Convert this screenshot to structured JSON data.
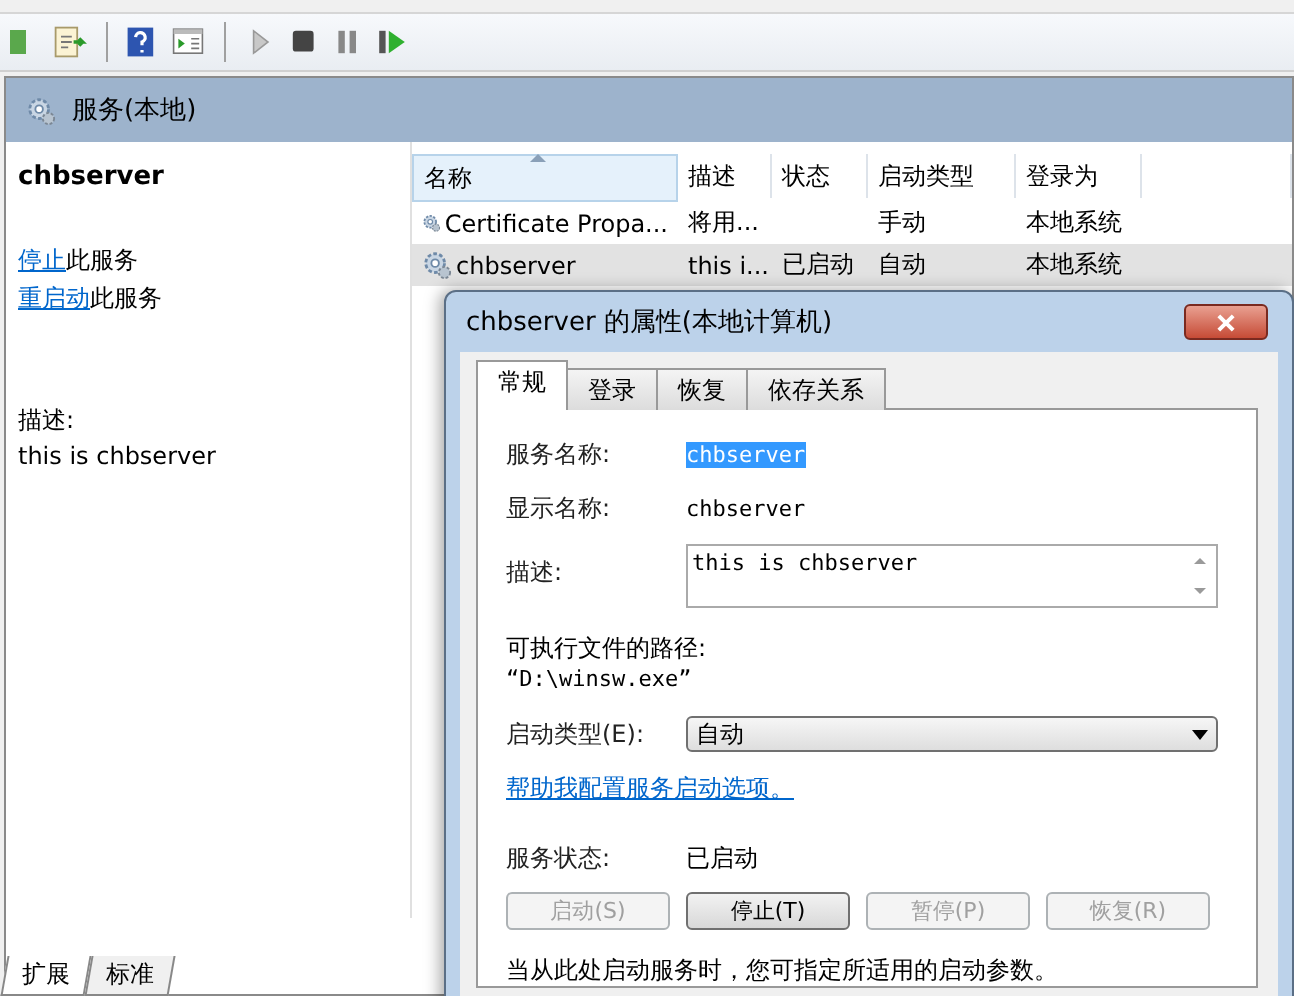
{
  "header": {
    "title": "服务(本地)"
  },
  "sidebar": {
    "service_name": "chbserver",
    "actions": [
      {
        "link": "停止",
        "text": "此服务"
      },
      {
        "link": "重启动",
        "text": "此服务"
      }
    ],
    "description_label": "描述:",
    "description": "this is chbserver"
  },
  "view_tabs": [
    {
      "label": "扩展",
      "selected": true
    },
    {
      "label": "标准",
      "selected": false
    }
  ],
  "table": {
    "columns": [
      "名称",
      "描述",
      "状态",
      "启动类型",
      "登录为"
    ],
    "rows": [
      {
        "cells": [
          "Certificate Propa...",
          "将用...",
          "",
          "手动",
          "本地系统"
        ],
        "selected": false
      },
      {
        "cells": [
          "chbserver",
          "this i...",
          "已启动",
          "自动",
          "本地系统"
        ],
        "selected": true
      }
    ]
  },
  "dialog": {
    "title": "chbserver 的属性(本地计算机)",
    "tabs": [
      {
        "label": "常规",
        "selected": true
      },
      {
        "label": "登录",
        "selected": false
      },
      {
        "label": "恢复",
        "selected": false
      },
      {
        "label": "依存关系",
        "selected": false
      }
    ],
    "service_name_label": "服务名称:",
    "service_name": "chbserver",
    "display_name_label": "显示名称:",
    "display_name": "chbserver",
    "description_label": "描述:",
    "description": "this is chbserver",
    "path_label": "可执行文件的路径:",
    "path": "“D:\\winsw.exe”",
    "startup_type_label": "启动类型(E):",
    "startup_type": "自动",
    "help_link": "帮助我配置服务启动选项。",
    "status_label": "服务状态:",
    "status": "已启动",
    "buttons": [
      {
        "label": "启动(S)",
        "disabled": true
      },
      {
        "label": "停止(T)",
        "disabled": false
      },
      {
        "label": "暂停(P)",
        "disabled": true
      },
      {
        "label": "恢复(R)",
        "disabled": true
      }
    ],
    "note": "当从此处启动服务时，您可指定所适用的启动参数。"
  }
}
